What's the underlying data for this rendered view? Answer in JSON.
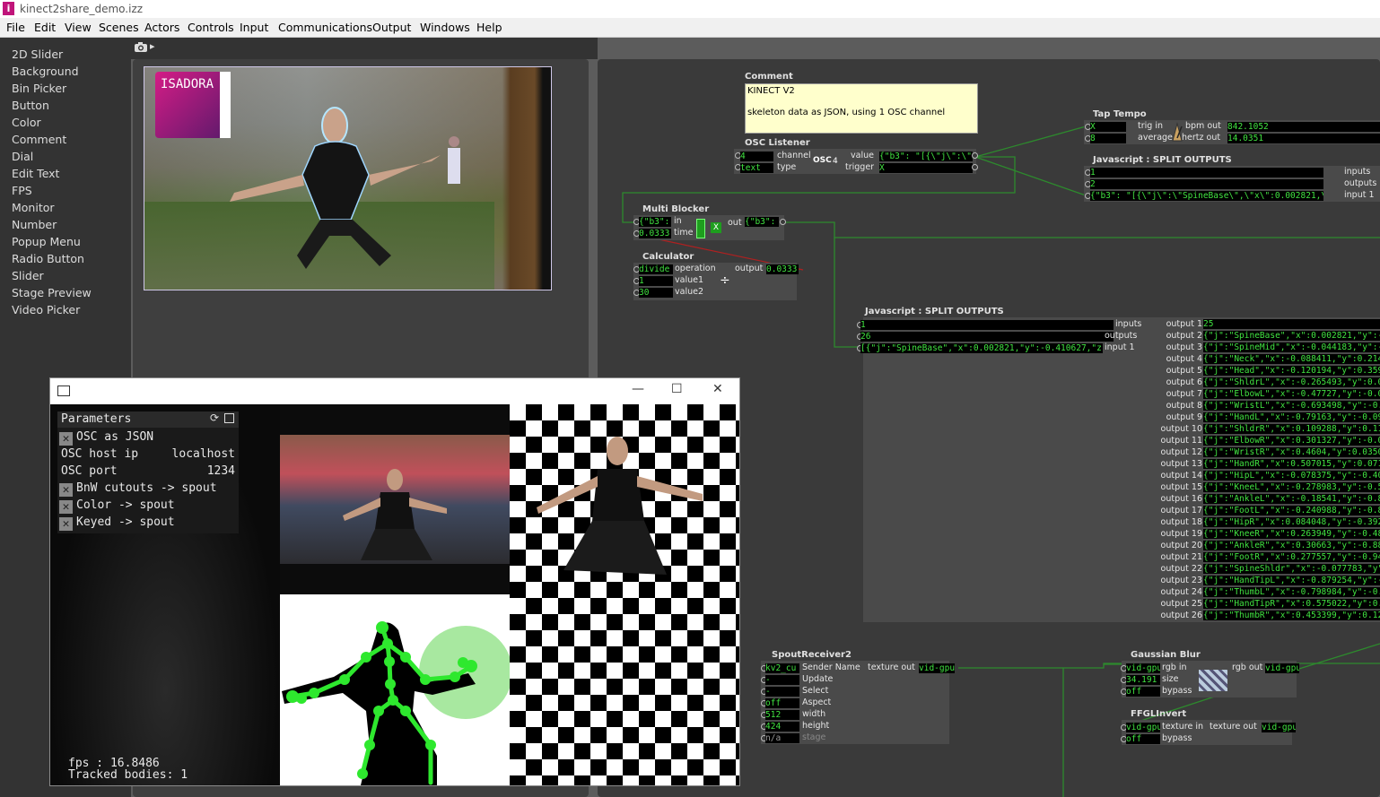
{
  "window": {
    "title": "kinect2share_demo.izz",
    "logo": "i"
  },
  "menu": [
    "File",
    "Edit",
    "View",
    "Scenes",
    "Actors",
    "Controls",
    "Input",
    "Communications",
    "Output",
    "Windows",
    "Help"
  ],
  "controls_list": [
    "2D Slider",
    "Background",
    "Bin Picker",
    "Button",
    "Color",
    "Comment",
    "Dial",
    "Edit Text",
    "FPS",
    "Monitor",
    "Number",
    "Popup Menu",
    "Radio Button",
    "Slider",
    "Stage Preview",
    "Video Picker"
  ],
  "stage": {
    "camera_icon": "camera-icon",
    "arrow": "▸",
    "logo_text": "ISADORA"
  },
  "comment": {
    "title": "Comment",
    "line1": "KINECT V2",
    "line2": "skeleton data as JSON, using 1 OSC channel"
  },
  "osc_listener": {
    "title": "OSC Listener",
    "channel": "4",
    "channel_label": "channel",
    "type_val": "text",
    "type_label": "type",
    "badge": "OSC",
    "badge_num": "4",
    "value_label": "value",
    "value": "{\"b3\": \"[{\\\"j\\\":\\\"Spin",
    "trigger_label": "trigger",
    "trigger": "X"
  },
  "tap_tempo": {
    "title": "Tap Tempo",
    "trig_in": "X",
    "trig_in_label": "trig in",
    "average": "8",
    "average_label": "average",
    "bpm_label": "bpm out",
    "bpm": "842.1052",
    "hertz_label": "hertz out",
    "hertz": "14.0351"
  },
  "js1": {
    "title": "Javascript : SPLIT OUTPUTS",
    "in1": "1",
    "in1_label": "inputs",
    "in2": "2",
    "in2_label": "outputs",
    "in3": "{\"b3\": \"[{\\\"j\\\":\\\"SpineBase\\\",\\\"x\\\":0.002821,\\\"y\\\":-0.4",
    "in3_label": "input 1"
  },
  "multi_blocker": {
    "title": "Multi Blocker",
    "in_val": "{\"b3\":",
    "in_label": "in",
    "time_val": "0.0333",
    "time_label": "time",
    "out_label": "out",
    "out_val": "{\"b3\":"
  },
  "calculator": {
    "title": "Calculator",
    "op_val": "divide",
    "op_label": "operation",
    "v1": "1",
    "v1_label": "value1",
    "v2": "30",
    "v2_label": "value2",
    "out_label": "output",
    "out_val": "0.0333"
  },
  "js2": {
    "title": "Javascript : SPLIT OUTPUTS",
    "in1": "1",
    "in1_label": "inputs",
    "in2": "26",
    "in2_label": "outputs",
    "in3": "[{\"j\":\"SpineBase\",\"x\":0.002821,\"y\":-0.410627,\"z\":1.5",
    "in3_label": "input 1",
    "outputs": [
      {
        "label": "output 1",
        "value": "25"
      },
      {
        "label": "output 2",
        "value": "{\"j\":\"SpineBase\",\"x\":0.002821,\"y\":-0"
      },
      {
        "label": "output 3",
        "value": "{\"j\":\"SpineMid\",\"x\":-0.044183,\"y\":-0."
      },
      {
        "label": "output 4",
        "value": "{\"j\":\"Neck\",\"x\":-0.088411,\"y\":0.2143"
      },
      {
        "label": "output 5",
        "value": "{\"j\":\"Head\",\"x\":-0.120194,\"y\":0.3592"
      },
      {
        "label": "output 6",
        "value": "{\"j\":\"ShldrL\",\"x\":-0.265493,\"y\":0.093"
      },
      {
        "label": "output 7",
        "value": "{\"j\":\"ElbowL\",\"x\":-0.47727,\"y\":-0.014"
      },
      {
        "label": "output 8",
        "value": "{\"j\":\"WristL\",\"x\":-0.693498,\"y\":-0.08"
      },
      {
        "label": "output 9",
        "value": "{\"j\":\"HandL\",\"x\":-0.79163,\"y\":-0.099"
      },
      {
        "label": "output 10",
        "value": "{\"j\":\"ShldrR\",\"x\":0.109288,\"y\":0.1195"
      },
      {
        "label": "output 11",
        "value": "{\"j\":\"ElbowR\",\"x\":0.301327,\"y\":-0.03"
      },
      {
        "label": "output 12",
        "value": "{\"j\":\"WristR\",\"x\":0.4604,\"y\":0.035069"
      },
      {
        "label": "output 13",
        "value": "{\"j\":\"HandR\",\"x\":0.507015,\"y\":0.0713"
      },
      {
        "label": "output 14",
        "value": "{\"j\":\"HipL\",\"x\":-0.078375,\"y\":-0.409"
      },
      {
        "label": "output 15",
        "value": "{\"j\":\"KneeL\",\"x\":-0.278983,\"y\":-0.53"
      },
      {
        "label": "output 16",
        "value": "{\"j\":\"AnkleL\",\"x\":-0.18541,\"y\":-0.860"
      },
      {
        "label": "output 17",
        "value": "{\"j\":\"FootL\",\"x\":-0.240988,\"y\":-0.821"
      },
      {
        "label": "output 18",
        "value": "{\"j\":\"HipR\",\"x\":0.084048,\"y\":-0.3927"
      },
      {
        "label": "output 19",
        "value": "{\"j\":\"KneeR\",\"x\":0.263949,\"y\":-0.483"
      },
      {
        "label": "output 20",
        "value": "{\"j\":\"AnkleR\",\"x\":0.30663,\"y\":-0.885"
      },
      {
        "label": "output 21",
        "value": "{\"j\":\"FootR\",\"x\":0.277557,\"y\":-0.949"
      },
      {
        "label": "output 22",
        "value": "{\"j\":\"SpineShldr\",\"x\":-0.077783,\"y\":0"
      },
      {
        "label": "output 23",
        "value": "{\"j\":\"HandTipL\",\"x\":-0.879254,\"y\":-0"
      },
      {
        "label": "output 24",
        "value": "{\"j\":\"ThumbL\",\"x\":-0.798984,\"y\":-0."
      },
      {
        "label": "output 25",
        "value": "{\"j\":\"HandTipR\",\"x\":0.575022,\"y\":0.1"
      },
      {
        "label": "output 26",
        "value": "{\"j\":\"ThumbR\",\"x\":0.453399,\"y\":0.12"
      }
    ]
  },
  "spout": {
    "title": "SpoutReceiver2",
    "rows": [
      {
        "val": "kv2_cu",
        "label": "Sender Name"
      },
      {
        "val": "-",
        "label": "Update"
      },
      {
        "val": "-",
        "label": "Select"
      },
      {
        "val": "off",
        "label": "Aspect"
      },
      {
        "val": "512",
        "label": "width"
      },
      {
        "val": "424",
        "label": "height"
      },
      {
        "val": "n/a",
        "label": "stage"
      }
    ],
    "out_label": "texture out",
    "out_val": "vid-gpu"
  },
  "gaussian": {
    "title": "Gaussian Blur",
    "rows": [
      {
        "val": "vid-gpu",
        "label": "rgb in"
      },
      {
        "val": "34.191",
        "label": "size"
      },
      {
        "val": "off",
        "label": "bypass"
      }
    ],
    "out_label": "rgb out",
    "out_val": "vid-gpu"
  },
  "ffgl": {
    "title": "FFGLInvert",
    "rows": [
      {
        "val": "vid-gpu",
        "label": "texture in"
      },
      {
        "val": "off",
        "label": "bypass"
      }
    ],
    "out_label": "texture out",
    "out_val": "vid-gpu"
  },
  "kinect_window": {
    "title_icon": "app-icon",
    "min": "—",
    "max": "☐",
    "close": "✕",
    "params_title": "Parameters",
    "params": [
      {
        "checked": true,
        "label": "OSC as JSON",
        "value": ""
      },
      {
        "checked": false,
        "label": "OSC host ip",
        "value": "localhost"
      },
      {
        "checked": false,
        "label": "OSC port",
        "value": "1234"
      },
      {
        "checked": true,
        "label": "BnW cutouts -> spout",
        "value": ""
      },
      {
        "checked": true,
        "label": "Color -> spout",
        "value": ""
      },
      {
        "checked": true,
        "label": "Keyed -> spout",
        "value": ""
      }
    ],
    "fps": "fps : 16.8486",
    "tracked": "Tracked bodies: 1"
  },
  "colors": {
    "accent_green": "#41e341",
    "wire": "#2d8a2d",
    "bg": "#3a3a3a"
  }
}
